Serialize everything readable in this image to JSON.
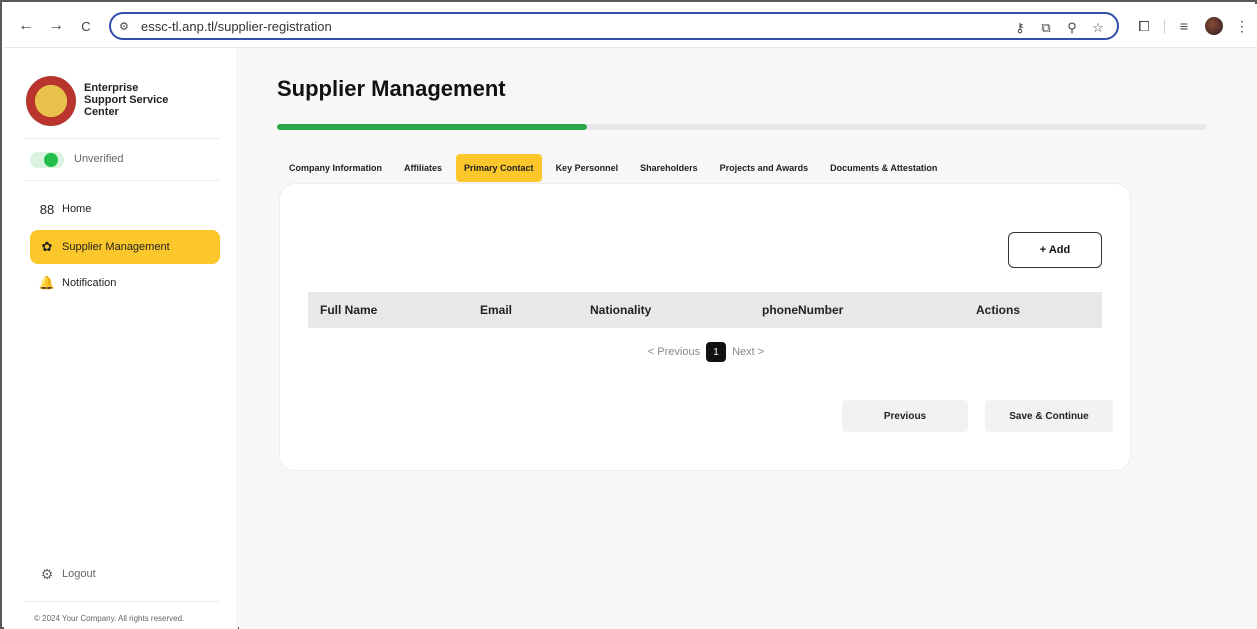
{
  "browser": {
    "url": "essc-tl.anp.tl/supplier-registration",
    "back_icon": "arrow-left-icon",
    "forward_icon": "arrow-right-icon",
    "reload_icon": "reload-icon",
    "back_glyph": "←",
    "forward_glyph": "→",
    "reload_glyph": "C",
    "site_glyph": "⚙"
  },
  "sidebar": {
    "brand_lines": [
      "Enterprise",
      "Support Service",
      "Center"
    ],
    "status_label": "Unverified",
    "items": [
      {
        "label": "Home",
        "icon": "grid-icon",
        "glyph": "88"
      },
      {
        "label": "Supplier Management",
        "icon": "network-icon",
        "glyph": "✿"
      },
      {
        "label": "Notification",
        "icon": "bell-icon",
        "glyph": "🔔"
      }
    ],
    "logout_label": "Logout",
    "logout_glyph": "⚙",
    "copyright": "© 2024 Your Company. All rights reserved."
  },
  "main": {
    "title": "Supplier Management",
    "progress_fraction": 0.333,
    "tabs": [
      {
        "label": "Company Information"
      },
      {
        "label": "Affiliates"
      },
      {
        "label": "Primary Contact"
      },
      {
        "label": "Key Personnel"
      },
      {
        "label": "Shareholders"
      },
      {
        "label": "Projects and Awards"
      },
      {
        "label": "Documents & Attestation"
      }
    ],
    "active_tab": "Primary Contact",
    "add_button": "+ Add",
    "table_headers": [
      "Full Name",
      "Email",
      "Nationality",
      "phoneNumber",
      "Actions"
    ],
    "pager": {
      "previous": "< Previous",
      "page": "1",
      "next": "Next >"
    },
    "previous_button": "Previous",
    "save_button": "Save & Continue"
  },
  "colors": {
    "accent": "#fcc72a",
    "progress": "#2aa84a",
    "status_green": "#22c04a"
  }
}
